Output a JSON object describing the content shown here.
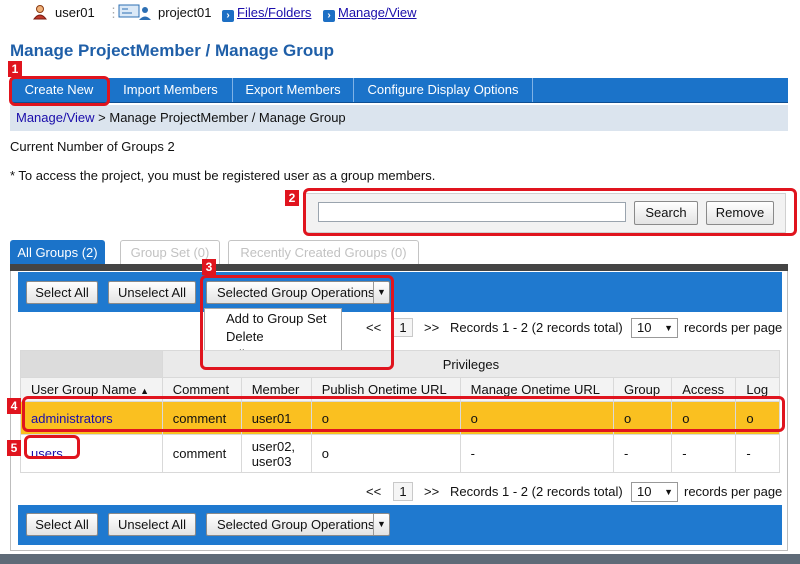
{
  "topbar": {
    "user": "user01",
    "project": "project01",
    "files_link": "Files/Folders",
    "manage_link": "Manage/View"
  },
  "page_title": "Manage ProjectMember / Manage Group",
  "menu": [
    "Create New",
    "Import Members",
    "Export Members",
    "Configure Display Options"
  ],
  "breadcrumb": {
    "link": "Manage/View",
    "rest": " > Manage ProjectMember / Manage Group"
  },
  "group_count": "Current Number of Groups 2",
  "note": "* To access the project, you must be registered user as a group members.",
  "search": {
    "value": "",
    "search_label": "Search",
    "remove_label": "Remove"
  },
  "tabs": [
    "All Groups (2)",
    "Group Set (0)",
    "Recently Created Groups (0)"
  ],
  "toolbar": {
    "select_all": "Select All",
    "unselect_all": "Unselect All",
    "group_ops": "Selected Group Operations"
  },
  "dropdown_items": [
    "Add to Group Set",
    "Delete",
    "Edit Comment"
  ],
  "pagination": {
    "prev": "<<",
    "page": "1",
    "next": ">>",
    "records": "Records 1 - 2 (2 records total)",
    "per_page_value": "10",
    "per_page_label": "records per page"
  },
  "table": {
    "privileges_header": "Privileges",
    "columns": [
      "User Group Name",
      "Comment",
      "Member",
      "Publish Onetime URL",
      "Manage Onetime URL",
      "Group",
      "Access",
      "Log"
    ],
    "sort_indicator": "▲",
    "rows": [
      {
        "name": "administrators",
        "comment": "comment",
        "member": "user01",
        "publish": "o",
        "manage": "o",
        "group": "o",
        "access": "o",
        "log": "o"
      },
      {
        "name": "users",
        "comment": "comment",
        "member_1": "user02,",
        "member_2": "user03",
        "publish": "o",
        "manage": "-",
        "group": "-",
        "access": "-",
        "log": "-"
      }
    ]
  },
  "badges": [
    "1",
    "2",
    "3",
    "4",
    "5"
  ],
  "colors": {
    "menu_blue": "#1b73c9",
    "highlight_row": "#fac020",
    "annotation_red": "#e0141e",
    "title_blue": "#1f5fa8"
  }
}
